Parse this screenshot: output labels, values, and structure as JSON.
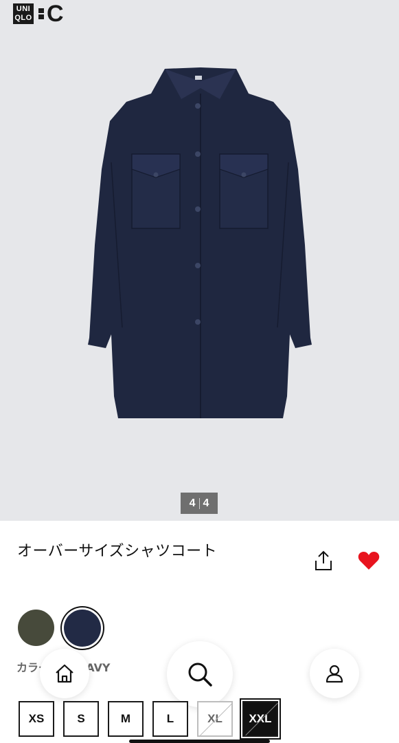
{
  "header": {
    "logo_line1": "UNI",
    "logo_line2": "QLO",
    "logo_c": "C"
  },
  "gallery": {
    "current": "4",
    "total": "4"
  },
  "product": {
    "title": "オーバーサイズシャツコート",
    "color_label": "カラー: 69 NAVY",
    "colors": [
      {
        "name": "olive",
        "hex": "#474a3b"
      },
      {
        "name": "navy",
        "hex": "#222a45",
        "selected": true
      }
    ],
    "favorite_color": "#e8141e"
  },
  "sizes": [
    {
      "label": "XS",
      "state": "available"
    },
    {
      "label": "S",
      "state": "available"
    },
    {
      "label": "M",
      "state": "available"
    },
    {
      "label": "L",
      "state": "available"
    },
    {
      "label": "XL",
      "state": "disabled"
    },
    {
      "label": "XXL",
      "state": "selected-disabled"
    }
  ],
  "nav": {
    "home_icon": "home-icon",
    "search_icon": "search-icon",
    "account_icon": "user-icon"
  }
}
